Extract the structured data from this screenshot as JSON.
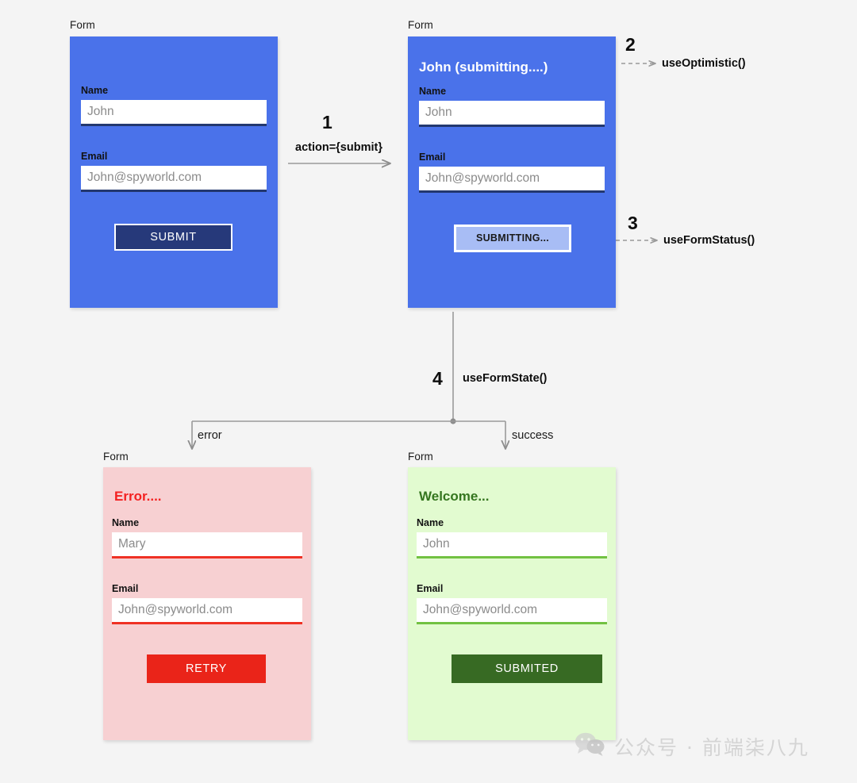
{
  "diagram": {
    "form_caption": "Form",
    "field_labels": {
      "name": "Name",
      "email": "Email"
    }
  },
  "form_initial": {
    "caption": "Form",
    "name_label": "Name",
    "name_value": "John",
    "email_label": "Email",
    "email_value": "John@spyworld.com",
    "submit_label": "SUBMIT",
    "bg_color": "#4a72ea",
    "button_color": "#26397a"
  },
  "form_submitting": {
    "caption": "Form",
    "heading": "John (submitting....)",
    "name_label": "Name",
    "name_value": "John",
    "email_label": "Email",
    "email_value": "John@spyworld.com",
    "submit_label": "SUBMITTING...",
    "bg_color": "#4a72ea",
    "button_color": "#a8bdf5"
  },
  "form_error": {
    "caption": "Form",
    "heading": "Error....",
    "name_label": "Name",
    "name_value": "Mary",
    "email_label": "Email",
    "email_value": "John@spyworld.com",
    "submit_label": "RETRY",
    "bg_color": "#f7d0d2",
    "accent_color": "#ef3124",
    "button_color": "#ea2419"
  },
  "form_success": {
    "caption": "Form",
    "heading": "Welcome...",
    "name_label": "Name",
    "name_value": "John",
    "email_label": "Email",
    "email_value": "John@spyworld.com",
    "submit_label": "SUBMITED",
    "bg_color": "#e2fbd0",
    "accent_color": "#72c142",
    "button_color": "#376a23"
  },
  "annotations": {
    "step1_num": "1",
    "step1_label": "action={submit}",
    "step2_num": "2",
    "step2_label": "useOptimistic()",
    "step3_num": "3",
    "step3_label": "useFormStatus()",
    "step4_num": "4",
    "step4_label": "useFormState()",
    "branch_error_label": "error",
    "branch_success_label": "success"
  },
  "watermark": {
    "text": "公众号 · 前端柒八九",
    "icon": "wechat-icon"
  }
}
